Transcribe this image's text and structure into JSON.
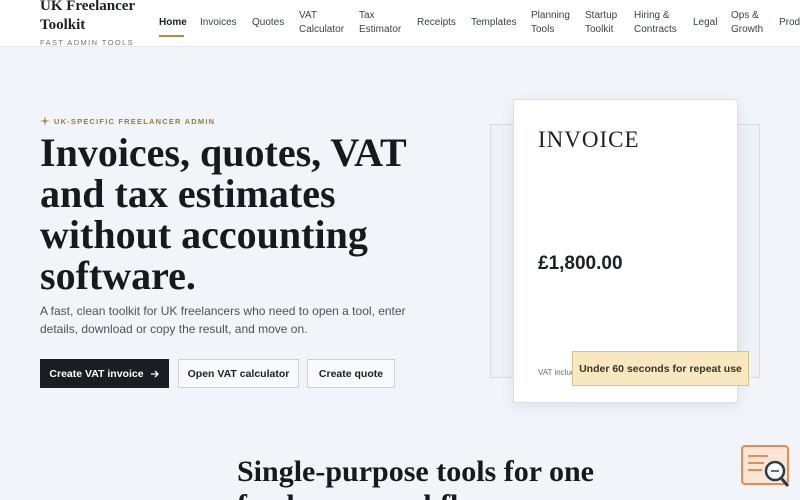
{
  "brand": {
    "name": "UK Freelancer Toolkit",
    "tagline": "FAST ADMIN TOOLS"
  },
  "nav": {
    "items": [
      {
        "label": "Home",
        "active": true
      },
      {
        "label": "Invoices"
      },
      {
        "label": "Quotes"
      },
      {
        "label": "VAT Calculator"
      },
      {
        "label": "Tax Estimator"
      },
      {
        "label": "Receipts"
      },
      {
        "label": "Templates"
      },
      {
        "label": "Planning Tools"
      },
      {
        "label": "Startup Toolkit"
      },
      {
        "label": "Hiring & Contracts"
      },
      {
        "label": "Legal"
      },
      {
        "label": "Ops & Growth"
      },
      {
        "label": "Prod"
      }
    ]
  },
  "hero": {
    "eyebrow": "UK-SPECIFIC FREELANCER ADMIN",
    "title": "Invoices, quotes, VAT and tax estimates without accounting software.",
    "subtitle": "A fast, clean toolkit for UK freelancers who need to open a tool, enter details, download or copy the result, and move on.",
    "buttons": {
      "primary": "Create VAT invoice",
      "secondary": "Open VAT calculator",
      "tertiary": "Create quote"
    }
  },
  "invoice_card": {
    "title": "INVOICE",
    "amount": "£1,800.00",
    "vat_note": "VAT included"
  },
  "badge": {
    "text": "Under 60 seconds for repeat use"
  },
  "section": {
    "title": "Single-purpose tools for one freelancer workflow"
  },
  "colors": {
    "accent": "#b08d45",
    "primary_button": "#1a1d22",
    "badge_bg": "#f7e8c1",
    "page_bg": "#f1f4f9"
  }
}
